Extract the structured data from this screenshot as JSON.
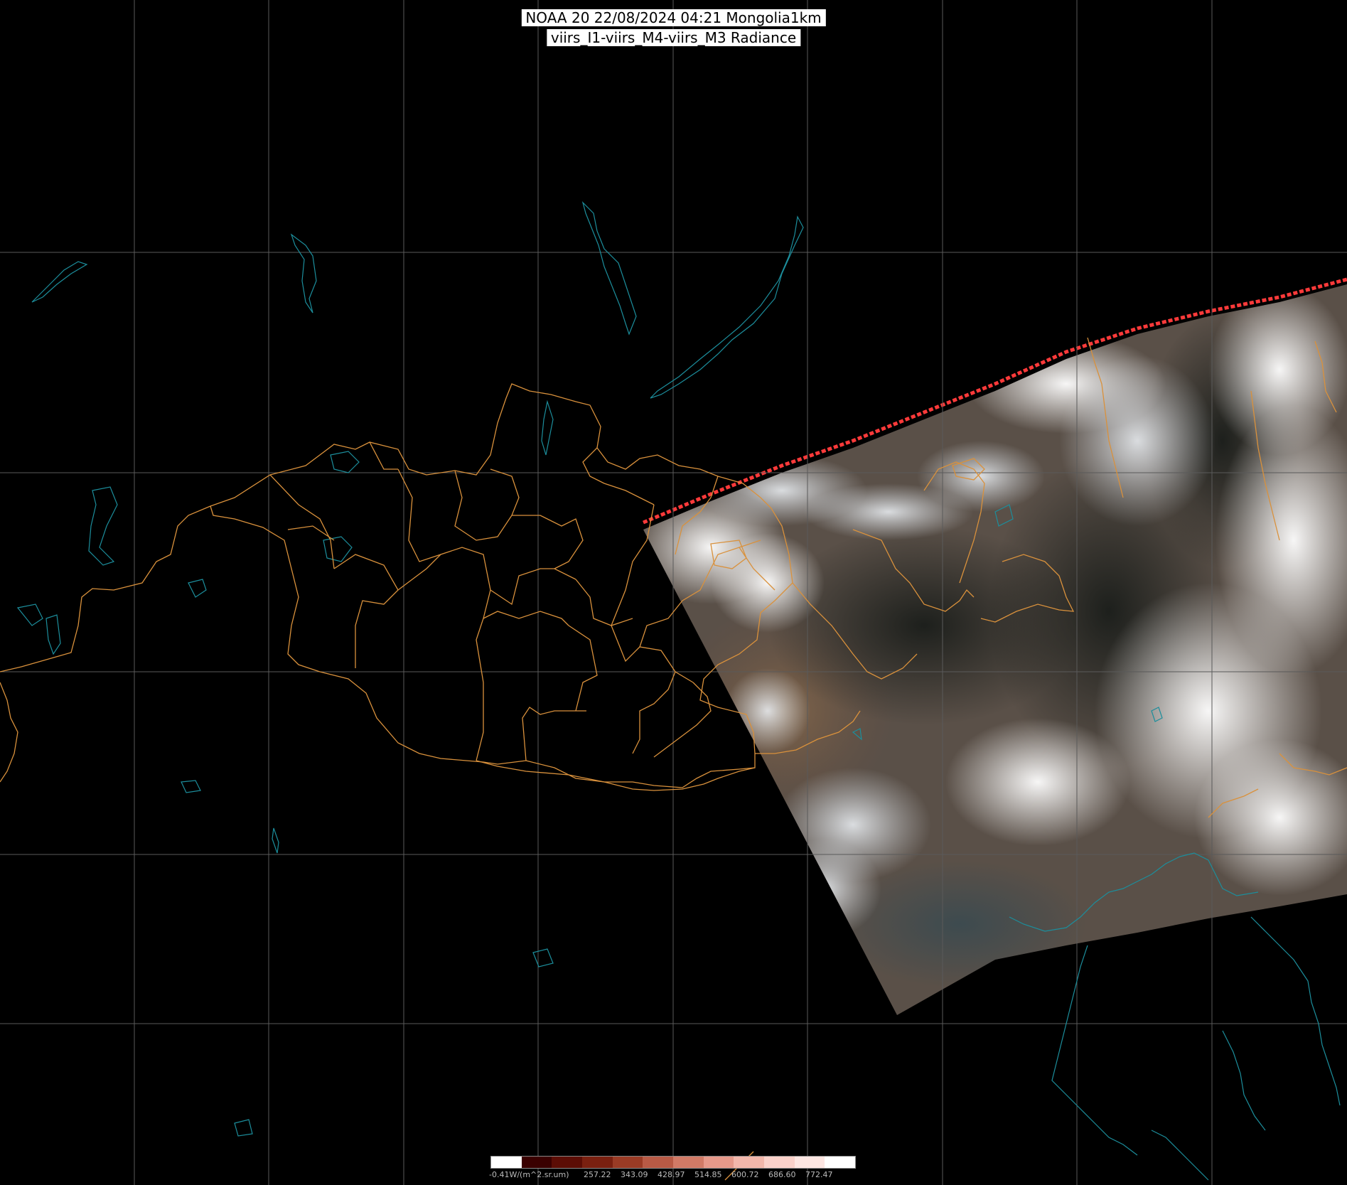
{
  "title": {
    "line1": "NOAA 20 22/08/2024 04:21 Mongolia1km",
    "line2": "viirs_I1-viirs_M4-viirs_M3 Radiance"
  },
  "colorbar": {
    "unit_label": "-0.41W/(m^2.sr.um)",
    "ticks": [
      "257.22",
      "343.09",
      "428.97",
      "514.85",
      "600.72",
      "686.60",
      "772.47"
    ],
    "colors": [
      "#ffffff",
      "#3a0000",
      "#5c0d05",
      "#7a2010",
      "#9a3b25",
      "#b85a45",
      "#d17a66",
      "#e6998a",
      "#f2b7ab",
      "#fad1ca",
      "#fde6e2",
      "#ffffff"
    ]
  },
  "colors": {
    "graticule": "#5a5a5a",
    "border": "#d9913c",
    "water": "#1c8e9c",
    "swath_edge": "#ff3a3a"
  }
}
